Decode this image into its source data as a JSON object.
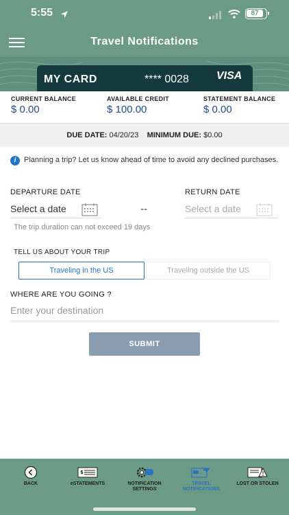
{
  "status_bar": {
    "time": "5:55",
    "battery": "87"
  },
  "header": {
    "title": "Travel Notifications"
  },
  "card": {
    "name": "MY CARD",
    "number": "**** 0028",
    "brand": "VISA"
  },
  "balances": [
    {
      "label": "CURRENT BALANCE",
      "value": "$ 0.00"
    },
    {
      "label": "AVAILABLE CREDIT",
      "value": "$ 100.00"
    },
    {
      "label": "STATEMENT BALANCE",
      "value": "$ 0.00"
    }
  ],
  "due": {
    "due_label": "DUE DATE:",
    "due_value": "04/20/23",
    "min_label": "MINIMUM DUE:",
    "min_value": "$0.00"
  },
  "info": {
    "text": "Planning a trip? Let us know ahead of time to avoid any declined purchases."
  },
  "form": {
    "departure_label": "DEPARTURE DATE",
    "return_label": "RETURN DATE",
    "departure_placeholder": "Select a date",
    "return_placeholder": "Select a date",
    "separator": "--",
    "duration_hint": "The trip duration can not exceed 19 days",
    "trip_label": "TELL US ABOUT YOUR TRIP",
    "toggle_us": "Traveling in the US",
    "toggle_outside": "Traveling outside the US",
    "destination_label": "WHERE ARE YOU GOING ?",
    "destination_placeholder": "Enter your destination",
    "submit_label": "SUBMIT"
  },
  "bottom_nav": [
    {
      "label": "BACK",
      "icon": "back-icon"
    },
    {
      "label": "eSTATEMENTS",
      "icon": "statement-icon"
    },
    {
      "label": "NOTIFICATION SETTINGS",
      "icon": "notification-settings-icon"
    },
    {
      "label": "TRAVEL NOTIFICATIONS",
      "icon": "travel-notification-icon",
      "active": true
    },
    {
      "label": "LOST OR STOLEN",
      "icon": "lost-card-icon"
    }
  ],
  "colors": {
    "header": "#6b9b86",
    "card": "#143a3d",
    "accent": "#1f75c9",
    "submit": "#8a9db0",
    "balance_text": "#1f4b8e"
  }
}
